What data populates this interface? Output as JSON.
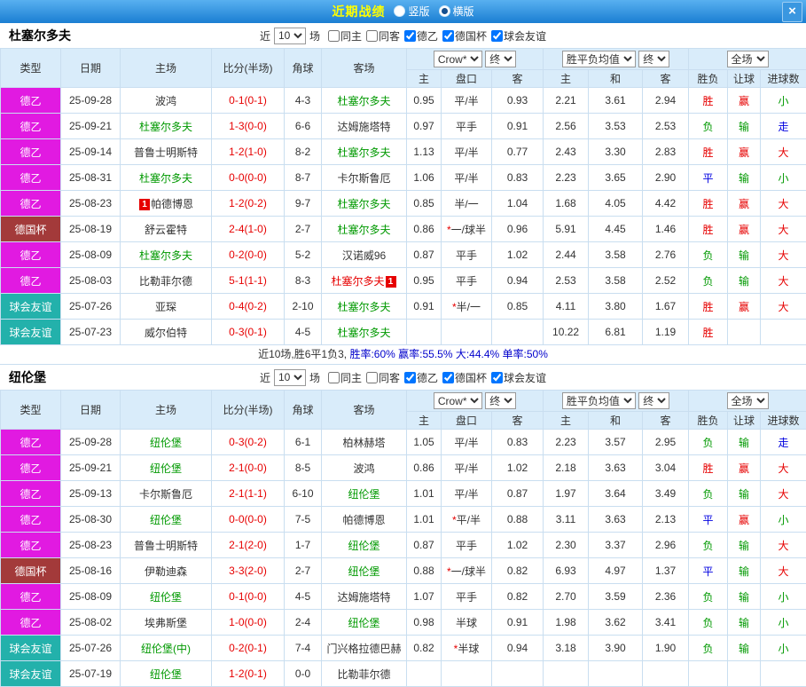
{
  "colors": {
    "topbar_start": "#58b0f0",
    "topbar_end": "#1a7ed2",
    "league_de2": "#e11ae1",
    "league_cup": "#a33a3a",
    "league_friendly": "#23b1ab",
    "result_red": "#e60000",
    "result_green": "#009900",
    "result_blue": "#0000e0",
    "team_green": "#009900",
    "score_red": "#e60000",
    "header_bg": "#d9ecfa",
    "grid_border": "#c9def0"
  },
  "topbar": {
    "title": "近期战绩",
    "radios": [
      {
        "label": "竖版",
        "selected": false
      },
      {
        "label": "横版",
        "selected": true
      }
    ],
    "close_label": "×"
  },
  "filter": {
    "near_label": "近",
    "games_value": "10",
    "games_suffix": "场",
    "checkboxes": [
      {
        "label": "同主",
        "checked": false
      },
      {
        "label": "同客",
        "checked": false
      },
      {
        "label": "德乙",
        "checked": true
      },
      {
        "label": "德国杯",
        "checked": true
      },
      {
        "label": "球会友谊",
        "checked": true
      }
    ]
  },
  "table_header": {
    "cols": [
      "类型",
      "日期",
      "主场",
      "比分(半场)",
      "角球",
      "客场"
    ],
    "odds_company": "Crow*",
    "odds_final": "终",
    "europe_avg": "胜平负均值",
    "europe_final": "终",
    "scope": "全场",
    "sub_cols": [
      "主",
      "盘口",
      "客",
      "主",
      "和",
      "客",
      "胜负",
      "让球",
      "进球数"
    ]
  },
  "result_colors": {
    "胜": "red",
    "赢": "red",
    "大": "red",
    "负": "green",
    "输": "green",
    "小": "green",
    "平": "blue",
    "走": "blue"
  },
  "sections": [
    {
      "team": "杜塞尔多夫",
      "rows": [
        {
          "type": "德乙",
          "type_key": "de2",
          "date": "25-09-28",
          "home": "波鸿",
          "score": "0-1(0-1)",
          "corner": "4-3",
          "away": "杜塞尔多夫",
          "away_focus": true,
          "odds_home": "0.95",
          "handicap": "平/半",
          "odds_away": "0.93",
          "avg_win": "2.21",
          "avg_draw": "3.61",
          "avg_lose": "2.94",
          "result": "胜",
          "handicap_result": "赢",
          "goal_result": "小"
        },
        {
          "type": "德乙",
          "type_key": "de2",
          "date": "25-09-21",
          "home": "杜塞尔多夫",
          "home_focus": true,
          "score": "1-3(0-0)",
          "corner": "6-6",
          "away": "达姆施塔特",
          "odds_home": "0.97",
          "handicap": "平手",
          "odds_away": "0.91",
          "avg_win": "2.56",
          "avg_draw": "3.53",
          "avg_lose": "2.53",
          "result": "负",
          "handicap_result": "输",
          "goal_result": "走"
        },
        {
          "type": "德乙",
          "type_key": "de2",
          "date": "25-09-14",
          "home": "普鲁士明斯特",
          "score": "1-2(1-0)",
          "corner": "8-2",
          "away": "杜塞尔多夫",
          "away_focus": true,
          "odds_home": "1.13",
          "handicap": "平/半",
          "odds_away": "0.77",
          "avg_win": "2.43",
          "avg_draw": "3.30",
          "avg_lose": "2.83",
          "result": "胜",
          "handicap_result": "赢",
          "goal_result": "大"
        },
        {
          "type": "德乙",
          "type_key": "de2",
          "date": "25-08-31",
          "home": "杜塞尔多夫",
          "home_focus": true,
          "score": "0-0(0-0)",
          "corner": "8-7",
          "away": "卡尔斯鲁厄",
          "odds_home": "1.06",
          "handicap": "平/半",
          "odds_away": "0.83",
          "avg_win": "2.23",
          "avg_draw": "3.65",
          "avg_lose": "2.90",
          "result": "平",
          "handicap_result": "输",
          "goal_result": "小"
        },
        {
          "type": "德乙",
          "type_key": "de2",
          "date": "25-08-23",
          "home": "帕德博恩",
          "home_badge": "1",
          "score": "1-2(0-2)",
          "corner": "9-7",
          "away": "杜塞尔多夫",
          "away_focus": true,
          "odds_home": "0.85",
          "handicap": "半/一",
          "odds_away": "1.04",
          "avg_win": "1.68",
          "avg_draw": "4.05",
          "avg_lose": "4.42",
          "result": "胜",
          "handicap_result": "赢",
          "goal_result": "大"
        },
        {
          "type": "德国杯",
          "type_key": "cup",
          "date": "25-08-19",
          "home": "舒云霍特",
          "score": "2-4(1-0)",
          "corner": "2-7",
          "away": "杜塞尔多夫",
          "away_focus": true,
          "odds_home": "0.86",
          "handicap": "*一/球半",
          "odds_away": "0.96",
          "avg_win": "5.91",
          "avg_draw": "4.45",
          "avg_lose": "1.46",
          "result": "胜",
          "handicap_result": "赢",
          "goal_result": "大"
        },
        {
          "type": "德乙",
          "type_key": "de2",
          "date": "25-08-09",
          "home": "杜塞尔多夫",
          "home_focus": true,
          "score": "0-2(0-0)",
          "corner": "5-2",
          "away": "汉诺威96",
          "odds_home": "0.87",
          "handicap": "平手",
          "odds_away": "1.02",
          "avg_win": "2.44",
          "avg_draw": "3.58",
          "avg_lose": "2.76",
          "result": "负",
          "handicap_result": "输",
          "goal_result": "大"
        },
        {
          "type": "德乙",
          "type_key": "de2",
          "date": "25-08-03",
          "home": "比勒菲尔德",
          "score": "5-1(1-1)",
          "corner": "8-3",
          "away": "杜塞尔多夫",
          "away_red": true,
          "away_badge": "1",
          "odds_home": "0.95",
          "handicap": "平手",
          "odds_away": "0.94",
          "avg_win": "2.53",
          "avg_draw": "3.58",
          "avg_lose": "2.52",
          "result": "负",
          "handicap_result": "输",
          "goal_result": "大"
        },
        {
          "type": "球会友谊",
          "type_key": "friendly",
          "date": "25-07-26",
          "home": "亚琛",
          "score": "0-4(0-2)",
          "corner": "2-10",
          "away": "杜塞尔多夫",
          "away_focus": true,
          "odds_home": "0.91",
          "handicap": "*半/一",
          "odds_away": "0.85",
          "avg_win": "4.11",
          "avg_draw": "3.80",
          "avg_lose": "1.67",
          "result": "胜",
          "handicap_result": "赢",
          "goal_result": "大"
        },
        {
          "type": "球会友谊",
          "type_key": "friendly",
          "date": "25-07-23",
          "home": "威尔伯特",
          "score": "0-3(0-1)",
          "corner": "4-5",
          "away": "杜塞尔多夫",
          "away_focus": true,
          "odds_home": "",
          "handicap": "",
          "odds_away": "",
          "avg_win": "10.22",
          "avg_draw": "6.81",
          "avg_lose": "1.19",
          "result": "胜",
          "handicap_result": "",
          "goal_result": ""
        }
      ],
      "summary": {
        "segments": [
          {
            "text": "近10场,胜6平1负3, ",
            "color": "#333333"
          },
          {
            "text": "胜率:60% ",
            "color": "#0000cc"
          },
          {
            "text": "赢率:55.5% ",
            "color": "#0000cc"
          },
          {
            "text": "大:44.4% ",
            "color": "#0000cc"
          },
          {
            "text": "单率:50%",
            "color": "#0000cc"
          }
        ]
      }
    },
    {
      "team": "纽伦堡",
      "rows": [
        {
          "type": "德乙",
          "type_key": "de2",
          "date": "25-09-28",
          "home": "纽伦堡",
          "home_focus": true,
          "score": "0-3(0-2)",
          "corner": "6-1",
          "away": "柏林赫塔",
          "odds_home": "1.05",
          "handicap": "平/半",
          "odds_away": "0.83",
          "avg_win": "2.23",
          "avg_draw": "3.57",
          "avg_lose": "2.95",
          "result": "负",
          "handicap_result": "输",
          "goal_result": "走"
        },
        {
          "type": "德乙",
          "type_key": "de2",
          "date": "25-09-21",
          "home": "纽伦堡",
          "home_focus": true,
          "score": "2-1(0-0)",
          "corner": "8-5",
          "away": "波鸿",
          "odds_home": "0.86",
          "handicap": "平/半",
          "odds_away": "1.02",
          "avg_win": "2.18",
          "avg_draw": "3.63",
          "avg_lose": "3.04",
          "result": "胜",
          "handicap_result": "赢",
          "goal_result": "大"
        },
        {
          "type": "德乙",
          "type_key": "de2",
          "date": "25-09-13",
          "home": "卡尔斯鲁厄",
          "score": "2-1(1-1)",
          "corner": "6-10",
          "away": "纽伦堡",
          "away_focus": true,
          "odds_home": "1.01",
          "handicap": "平/半",
          "odds_away": "0.87",
          "avg_win": "1.97",
          "avg_draw": "3.64",
          "avg_lose": "3.49",
          "result": "负",
          "handicap_result": "输",
          "goal_result": "大"
        },
        {
          "type": "德乙",
          "type_key": "de2",
          "date": "25-08-30",
          "home": "纽伦堡",
          "home_focus": true,
          "score": "0-0(0-0)",
          "corner": "7-5",
          "away": "帕德博恩",
          "odds_home": "1.01",
          "handicap": "*平/半",
          "odds_away": "0.88",
          "avg_win": "3.11",
          "avg_draw": "3.63",
          "avg_lose": "2.13",
          "result": "平",
          "handicap_result": "赢",
          "goal_result": "小"
        },
        {
          "type": "德乙",
          "type_key": "de2",
          "date": "25-08-23",
          "home": "普鲁士明斯特",
          "score": "2-1(2-0)",
          "corner": "1-7",
          "away": "纽伦堡",
          "away_focus": true,
          "odds_home": "0.87",
          "handicap": "平手",
          "odds_away": "1.02",
          "avg_win": "2.30",
          "avg_draw": "3.37",
          "avg_lose": "2.96",
          "result": "负",
          "handicap_result": "输",
          "goal_result": "大"
        },
        {
          "type": "德国杯",
          "type_key": "cup",
          "date": "25-08-16",
          "home": "伊勒迪森",
          "score": "3-3(2-0)",
          "corner": "2-7",
          "away": "纽伦堡",
          "away_focus": true,
          "odds_home": "0.88",
          "handicap": "*一/球半",
          "odds_away": "0.82",
          "avg_win": "6.93",
          "avg_draw": "4.97",
          "avg_lose": "1.37",
          "result": "平",
          "handicap_result": "输",
          "goal_result": "大"
        },
        {
          "type": "德乙",
          "type_key": "de2",
          "date": "25-08-09",
          "home": "纽伦堡",
          "home_focus": true,
          "score": "0-1(0-0)",
          "corner": "4-5",
          "away": "达姆施塔特",
          "odds_home": "1.07",
          "handicap": "平手",
          "odds_away": "0.82",
          "avg_win": "2.70",
          "avg_draw": "3.59",
          "avg_lose": "2.36",
          "result": "负",
          "handicap_result": "输",
          "goal_result": "小"
        },
        {
          "type": "德乙",
          "type_key": "de2",
          "date": "25-08-02",
          "home": "埃弗斯堡",
          "score": "1-0(0-0)",
          "corner": "2-4",
          "away": "纽伦堡",
          "away_focus": true,
          "odds_home": "0.98",
          "handicap": "半球",
          "odds_away": "0.91",
          "avg_win": "1.98",
          "avg_draw": "3.62",
          "avg_lose": "3.41",
          "result": "负",
          "handicap_result": "输",
          "goal_result": "小"
        },
        {
          "type": "球会友谊",
          "type_key": "friendly",
          "date": "25-07-26",
          "home": "纽伦堡(中)",
          "home_focus": true,
          "score": "0-2(0-1)",
          "corner": "7-4",
          "away": "门兴格拉德巴赫",
          "odds_home": "0.82",
          "handicap": "*半球",
          "odds_away": "0.94",
          "avg_win": "3.18",
          "avg_draw": "3.90",
          "avg_lose": "1.90",
          "result": "负",
          "handicap_result": "输",
          "goal_result": "小"
        },
        {
          "type": "球会友谊",
          "type_key": "friendly",
          "date": "25-07-19",
          "home": "纽伦堡",
          "home_focus": true,
          "score": "1-2(0-1)",
          "corner": "0-0",
          "away": "比勒菲尔德",
          "odds_home": "",
          "handicap": "",
          "odds_away": "",
          "avg_win": "",
          "avg_draw": "",
          "avg_lose": "",
          "result": "",
          "handicap_result": "",
          "goal_result": ""
        }
      ]
    }
  ]
}
